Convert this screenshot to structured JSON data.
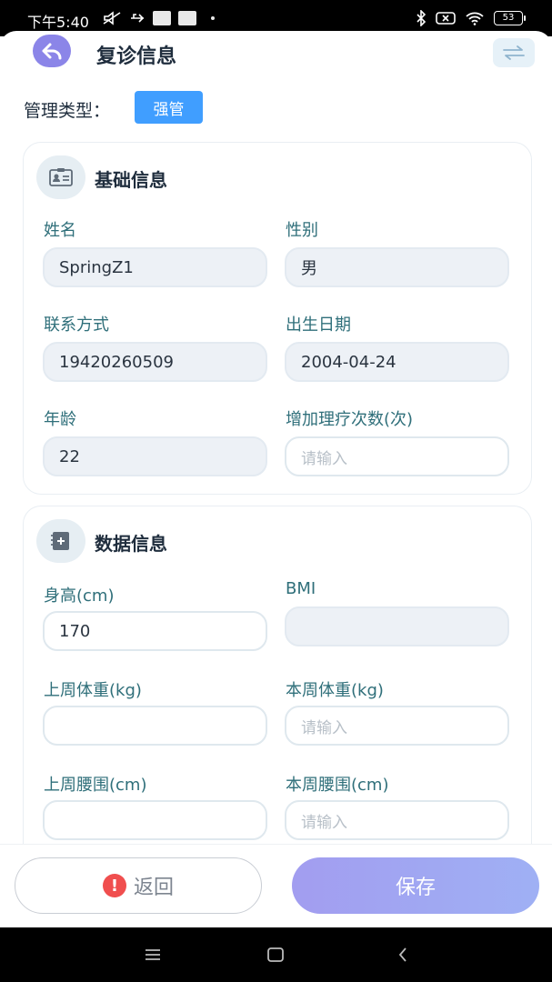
{
  "status_bar": {
    "time": "下午5:40",
    "battery": "53"
  },
  "header": {
    "title": "复诊信息"
  },
  "management": {
    "label": "管理类型：",
    "tag": "强管"
  },
  "basic_info": {
    "title": "基础信息",
    "fields": {
      "name": {
        "label": "姓名",
        "value": "SpringZ1"
      },
      "gender": {
        "label": "性别",
        "value": "男"
      },
      "contact": {
        "label": "联系方式",
        "value": "19420260509"
      },
      "birthdate": {
        "label": "出生日期",
        "value": "2004-04-24"
      },
      "age": {
        "label": "年龄",
        "value": "22"
      },
      "therapy_count": {
        "label": "增加理疗次数(次)",
        "placeholder": "请输入"
      }
    }
  },
  "data_info": {
    "title": "数据信息",
    "fields": {
      "height": {
        "label": "身高(cm)",
        "value": "170"
      },
      "bmi": {
        "label": "BMI",
        "value": ""
      },
      "last_week_weight": {
        "label": "上周体重(kg)",
        "value": ""
      },
      "this_week_weight": {
        "label": "本周体重(kg)",
        "placeholder": "请输入"
      },
      "last_week_waist": {
        "label": "上周腰围(cm)",
        "value": ""
      },
      "this_week_waist": {
        "label": "本周腰围(cm)",
        "placeholder": "请输入"
      }
    }
  },
  "footer": {
    "return_label": "返回",
    "save_label": "保存"
  },
  "icons": {
    "back": "arrow-back-icon",
    "switch": "swap-arrows-icon",
    "basic": "id-card-icon",
    "data": "add-record-icon",
    "warn": "exclamation-icon"
  },
  "colors": {
    "accent": "#8b85e8",
    "tag": "#409eff",
    "label": "#2f6f7a",
    "warning": "#f04e4e"
  }
}
